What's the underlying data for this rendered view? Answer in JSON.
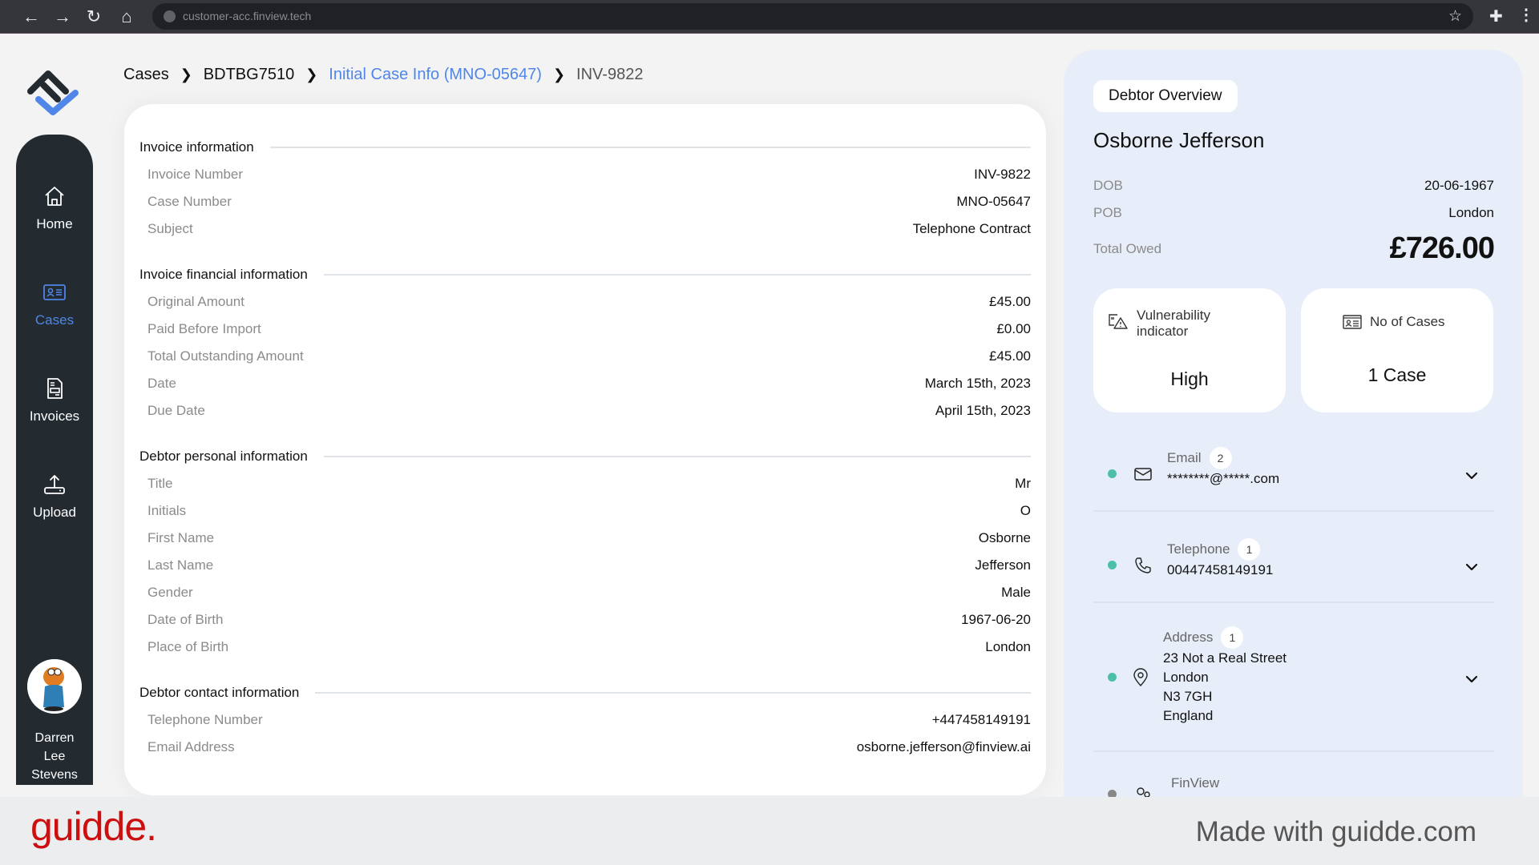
{
  "browser": {
    "url": "customer-acc.finview.tech"
  },
  "sidebar": {
    "items": [
      {
        "label": "Home",
        "icon": "home-icon",
        "active": false
      },
      {
        "label": "Cases",
        "icon": "id-card-icon",
        "active": true
      },
      {
        "label": "Invoices",
        "icon": "invoice-icon",
        "active": false
      },
      {
        "label": "Upload",
        "icon": "upload-icon",
        "active": false
      }
    ],
    "user": {
      "line1": "Darren",
      "line2": "Lee",
      "line3": "Stevens"
    }
  },
  "breadcrumb": {
    "items": [
      "Cases",
      "BDTBG7510",
      "Initial Case Info (MNO-05647)",
      "INV-9822"
    ],
    "separator": "❯"
  },
  "main": {
    "sections": [
      {
        "title": "Invoice information",
        "rows": [
          {
            "label": "Invoice Number",
            "value": "INV-9822"
          },
          {
            "label": "Case Number",
            "value": "MNO-05647"
          },
          {
            "label": "Subject",
            "value": "Telephone Contract"
          }
        ]
      },
      {
        "title": "Invoice financial information",
        "rows": [
          {
            "label": "Original Amount",
            "value": "£45.00"
          },
          {
            "label": "Paid Before Import",
            "value": "£0.00"
          },
          {
            "label": "Total Outstanding Amount",
            "value": "£45.00"
          },
          {
            "label": "Date",
            "value": "March 15th, 2023"
          },
          {
            "label": "Due Date",
            "value": "April 15th, 2023"
          }
        ]
      },
      {
        "title": "Debtor personal information",
        "rows": [
          {
            "label": "Title",
            "value": "Mr"
          },
          {
            "label": "Initials",
            "value": "O"
          },
          {
            "label": "First Name",
            "value": "Osborne"
          },
          {
            "label": "Last Name",
            "value": "Jefferson"
          },
          {
            "label": "Gender",
            "value": "Male"
          },
          {
            "label": "Date of Birth",
            "value": "1967-06-20"
          },
          {
            "label": "Place of Birth",
            "value": "London"
          }
        ]
      },
      {
        "title": "Debtor contact information",
        "rows": [
          {
            "label": "Telephone Number",
            "value": "+447458149191"
          },
          {
            "label": "Email Address",
            "value": "osborne.jefferson@finview.ai"
          }
        ]
      }
    ]
  },
  "debtor": {
    "tag": "Debtor Overview",
    "name": "Osborne Jefferson",
    "dob_label": "DOB",
    "dob": "20-06-1967",
    "pob_label": "POB",
    "pob": "London",
    "total_owed_label": "Total Owed",
    "total_owed": "£726.00",
    "vulnerability": {
      "line1": "Vulnerability",
      "line2": "indicator",
      "value": "High"
    },
    "cases": {
      "label": "No of Cases",
      "value": "1 Case"
    },
    "contacts": [
      {
        "title": "Email",
        "count": "2",
        "value": "********@*****.com",
        "status_color": "#4dbfa8"
      },
      {
        "title": "Telephone",
        "count": "1",
        "value": "00447458149191",
        "status_color": "#4dbfa8"
      },
      {
        "title": "Address",
        "count": "1",
        "lines": [
          "23 Not a Real Street",
          "London",
          "N3 7GH",
          "England"
        ],
        "status_color": "#4dbfa8"
      },
      {
        "title": "FinView",
        "status_color": "#888888"
      }
    ]
  },
  "footer": {
    "brand": "guidde.",
    "made_with": "Made with guidde.com"
  },
  "colors": {
    "accent": "#4f86e8",
    "sidebar_bg": "#232b31",
    "panel_bg": "#e8eef9",
    "status_green": "#4dbfa8",
    "brand_red": "#cc1010"
  }
}
